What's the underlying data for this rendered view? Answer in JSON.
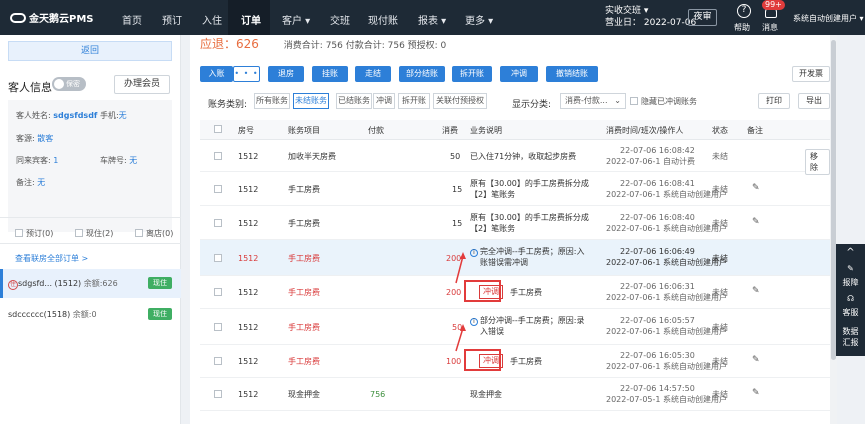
{
  "nav": {
    "logo": "金天鹅云PMS",
    "items": [
      {
        "label": "首页",
        "name": "nav-home"
      },
      {
        "label": "预订",
        "name": "nav-booking"
      },
      {
        "label": "入住",
        "name": "nav-checkin"
      },
      {
        "label": "订单",
        "name": "nav-orders"
      },
      {
        "label": "客户 ▾",
        "name": "nav-customers"
      },
      {
        "label": "交班",
        "name": "nav-shift-handover"
      },
      {
        "label": "现付账",
        "name": "nav-cash-account"
      },
      {
        "label": "报表 ▾",
        "name": "nav-reports"
      },
      {
        "label": "更多 ▾",
        "name": "nav-more"
      }
    ],
    "shift_line1": "实收交班 ▾",
    "shift_line2": "营业日： 2022-07-06",
    "night_audit": "夜审",
    "help": "帮助",
    "messages": "消息",
    "message_badge": "99+",
    "user": "系统自动创建用户 ▾"
  },
  "left": {
    "back": "返回",
    "guest_info_title": "客人信息",
    "toggle_label": "保密",
    "member_button": "办理会员",
    "guest_name_label": "客人姓名:",
    "guest_name": "sdgsfdsdf",
    "phone_label": "手机:",
    "phone": "无",
    "source_label": "客源:",
    "source": "散客",
    "companions_label": "同来宾客:",
    "companions": "1",
    "plate_label": "车牌号:",
    "plate": "无",
    "remark_label": "备注:",
    "remark": "无",
    "filters": [
      "预订(0)",
      "现住(2)",
      "离店(0)"
    ],
    "view_all": "查看联房全部订单 >",
    "rooms": [
      {
        "label": "sdgsfd... (1512)",
        "balance": "余额:626",
        "status": "现住"
      },
      {
        "label": "sdcccccc(1518)",
        "balance": "余额:0",
        "status": "现住"
      }
    ]
  },
  "main": {
    "top_label": "应退：",
    "top_amount": "626",
    "top_rest": "消费合计: 756    付款合计: 756    预授权: 0",
    "actions": [
      "入账",
      "• • •",
      "退房",
      "挂账",
      "走结",
      "部分结账",
      "拆开账",
      "冲调",
      "撤销结账"
    ],
    "open_invoice": "开发票",
    "print": "打印",
    "export": "导出",
    "tabs_label": "账务类别:",
    "tabs": [
      "所有账务",
      "未结账务",
      "已结账务",
      "冲调",
      "拆开账",
      "关联付预授权"
    ],
    "display_label": "显示分类:",
    "display_value": "消费-付款...",
    "hide_offset": "隐藏已冲调账务",
    "columns": [
      "房号",
      "账务项目",
      "付款",
      "消费",
      "业务说明",
      "消费时间/班次/操作人",
      "状态",
      "备注"
    ],
    "rows": [
      {
        "room": "1512",
        "item": "加收半天房费",
        "pay": "",
        "amount": "50",
        "desc": "已入住71分钟，收取起步房费",
        "desc2": "",
        "time1": "22-07-06 16:08:42",
        "time2": "2022-07-06-1 自动计费",
        "status": "未结",
        "action": "移除"
      },
      {
        "room": "1512",
        "item": "手工房费",
        "pay": "",
        "amount": "15",
        "desc": "原有【30.00】的手工房费拆分成",
        "desc2": "【2】笔账务",
        "time1": "22-07-06 16:08:41",
        "time2": "2022-07-06-1 系统自动创建用户",
        "status": "未结",
        "action": "✎"
      },
      {
        "room": "1512",
        "item": "手工房费",
        "pay": "",
        "amount": "15",
        "desc": "原有【30.00】的手工房费拆分成",
        "desc2": "【2】笔账务",
        "time1": "22-07-06 16:08:40",
        "time2": "2022-07-06-1 系统自动创建用户",
        "status": "未结",
        "action": "✎"
      },
      {
        "room": "1512",
        "item": "手工房费",
        "pay": "",
        "amount": "200",
        "desc": "完全冲调--手工房费；原因:入",
        "desc2": "账错误需冲调",
        "time1": "22-07-06 16:06:49",
        "time2": "2022-07-06-1 系统自动创建用户",
        "status": "未结",
        "action": ""
      },
      {
        "room": "1512",
        "item": "手工房费",
        "pay": "",
        "amount": "200",
        "desc": "手工房费",
        "desc2": "",
        "tag": "冲调",
        "time1": "22-07-06 16:06:31",
        "time2": "2022-07-06-1 系统自动创建用户",
        "status": "未结",
        "action": "✎"
      },
      {
        "room": "1512",
        "item": "手工房费",
        "pay": "",
        "amount": "50",
        "desc": "部分冲调--手工房费；原因:录",
        "desc2": "入错误",
        "time1": "22-07-06 16:05:57",
        "time2": "2022-07-06-1 系统自动创建用户",
        "status": "未结",
        "action": ""
      },
      {
        "room": "1512",
        "item": "手工房费",
        "pay": "",
        "amount": "100",
        "desc": "手工房费",
        "desc2": "",
        "tag": "冲调",
        "time1": "22-07-06 16:05:30",
        "time2": "2022-07-06-1 系统自动创建用户",
        "status": "未结",
        "action": "✎"
      },
      {
        "room": "1512",
        "item": "现金押金",
        "pay": "756",
        "amount": "",
        "desc": "现金押金",
        "desc2": "",
        "time1": "22-07-06 14:57:50",
        "time2": "2022-07-05-1 系统自动创建用户",
        "status": "未结",
        "action": "✎"
      }
    ]
  },
  "right_tools": [
    "报障",
    "客服",
    "数据汇报"
  ],
  "colors": {
    "nav": "#1e2a36",
    "accent": "#2d7fd8",
    "red": "#d93a3a",
    "green": "#3fae63"
  }
}
